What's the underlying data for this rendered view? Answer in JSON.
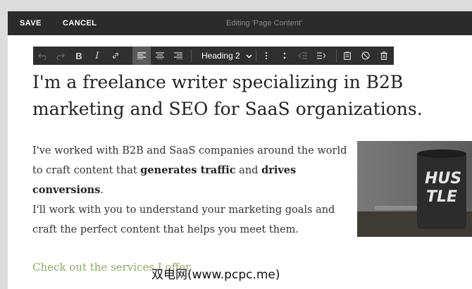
{
  "topbar": {
    "save_label": "SAVE",
    "cancel_label": "CANCEL",
    "title": "Editing 'Page Content'"
  },
  "toolbar": {
    "heading_select": "Heading 2",
    "icons": [
      "undo-icon",
      "redo-icon",
      "bold-icon",
      "italic-icon",
      "link-icon",
      "align-left-icon",
      "align-center-icon",
      "align-right-icon",
      "chevron-down-icon",
      "bulleted-list-icon",
      "numbered-list-icon",
      "outdent-icon",
      "indent-icon",
      "clipboard-icon",
      "block-icon",
      "trash-icon"
    ]
  },
  "content": {
    "headline": "I'm a freelance writer specializing in B2B marketing and SEO for SaaS organizations.",
    "p1": {
      "text_a": "I've worked with B2B and SaaS companies around the world to craft content that ",
      "bold_a": "generates traffic",
      "text_b": " and ",
      "bold_b": "drives conversions",
      "text_c": "."
    },
    "p2": "I'll work with you to understand your marketing goals and craft the perfect content that helps you meet them.",
    "cta": "Check out the services I offer",
    "photo_mug_text": "HUS\nTLE"
  },
  "watermark": "双电网(www.pcpc.me)",
  "colors": {
    "topbar_bg": "#2b2b2b",
    "toolbar_bg": "#2f2f2f",
    "cta_green": "#8ea86b",
    "text": "#333333"
  }
}
